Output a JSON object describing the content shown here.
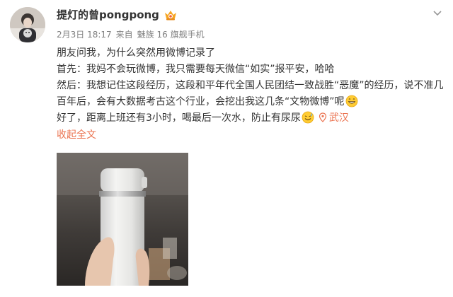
{
  "user": {
    "name": "提灯的曾pongpong",
    "avatar_icon": "avatar-photo-icon",
    "vip_icon": "vip-crown-icon"
  },
  "meta": {
    "time": "2月3日 18:17",
    "from_label": "来自",
    "device": "魅族 16 旗舰手机"
  },
  "post": {
    "line1": "朋友问我，为什么突然用微博记录了",
    "line2": "首先：我妈不会玩微博，我只需要每天微信“如实”报平安，哈哈",
    "line3": "然后：我想记住这段经历，这段和平年代全国人民团结一致战胜“恶魔”的经历，说不准几百年后，会有大数据考古这个行业，会挖出我这几条“文物微博”呢",
    "line4": "好了，距离上班还有3小时，喝最后一次水，防止有尿尿",
    "emoji_grin": "grin-emoji-icon",
    "emoji_sweat": "sweat-smile-emoji-icon",
    "location": "武汉",
    "collapse_label": "收起全文"
  },
  "colors": {
    "link": "#eb7350",
    "meta": "#808080",
    "text": "#333333"
  }
}
